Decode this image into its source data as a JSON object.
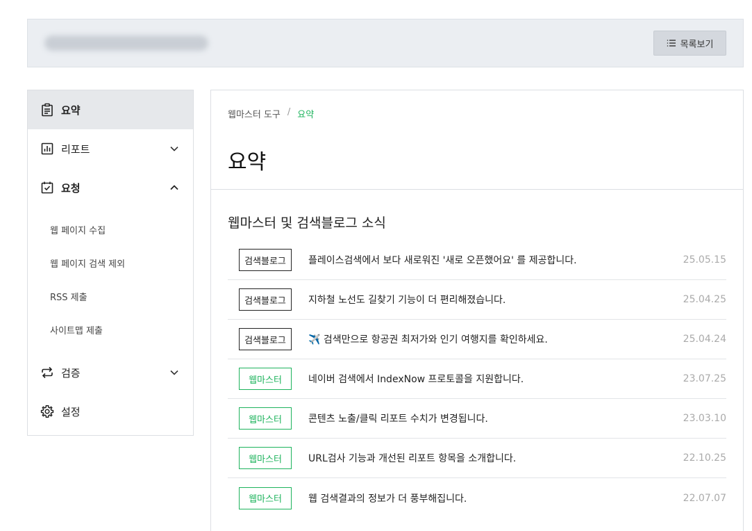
{
  "header": {
    "list_button_label": "목록보기"
  },
  "sidebar": {
    "items": [
      {
        "label": "요약"
      },
      {
        "label": "리포트"
      },
      {
        "label": "요청"
      },
      {
        "label": "검증"
      },
      {
        "label": "설정"
      }
    ],
    "request_subitems": [
      {
        "label": "웹 페이지 수집"
      },
      {
        "label": "웹 페이지 검색 제외"
      },
      {
        "label": "RSS 제출"
      },
      {
        "label": "사이트맵 제출"
      }
    ]
  },
  "breadcrumb": {
    "root": "웹마스터 도구",
    "separator": "/",
    "current": "요약"
  },
  "page": {
    "title": "요약",
    "section_title": "웹마스터 및 검색블로그 소식"
  },
  "news": [
    {
      "tag": "검색블로그",
      "title": "플레이스검색에서 보다 새로워진 '새로 오픈했어요' 를 제공합니다.",
      "date": "25.05.15"
    },
    {
      "tag": "검색블로그",
      "title": "지하철 노선도 길찾기 기능이 더 편리해졌습니다.",
      "date": "25.04.25"
    },
    {
      "tag": "검색블로그",
      "title": "✈️ 검색만으로 항공권 최저가와 인기 여행지를 확인하세요.",
      "date": "25.04.24"
    },
    {
      "tag": "웹마스터",
      "title": "네이버 검색에서 IndexNow 프로토콜을 지원합니다.",
      "date": "23.07.25"
    },
    {
      "tag": "웹마스터",
      "title": "콘텐츠 노출/클릭 리포트 수치가 변경됩니다.",
      "date": "23.03.10"
    },
    {
      "tag": "웹마스터",
      "title": "URL검사 기능과 개선된 리포트 항목을 소개합니다.",
      "date": "22.10.25"
    },
    {
      "tag": "웹마스터",
      "title": "웹 검색결과의 정보가 더 풍부해집니다.",
      "date": "22.07.07"
    }
  ],
  "colors": {
    "accent_green": "#1db35c",
    "topbar_bg": "#ebeef2"
  }
}
